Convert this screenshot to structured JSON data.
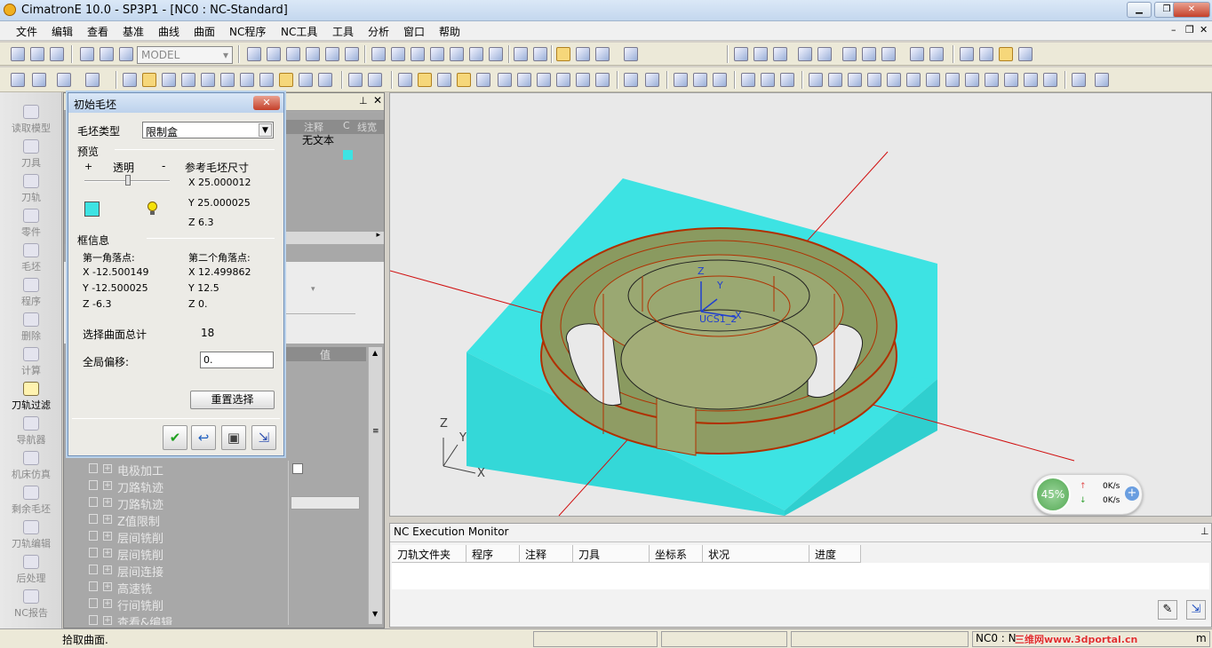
{
  "window": {
    "title": "CimatronE 10.0 - SP3P1 - [NC0 : NC-Standard]"
  },
  "menu": [
    "文件",
    "编辑",
    "查看",
    "基准",
    "曲线",
    "曲面",
    "NC程序",
    "NC工具",
    "工具",
    "分析",
    "窗口",
    "帮助"
  ],
  "model_combo": "MODEL",
  "sidebar": [
    {
      "label": "读取模型",
      "active": false
    },
    {
      "label": "刀具",
      "active": false
    },
    {
      "label": "刀轨",
      "active": false
    },
    {
      "label": "零件",
      "active": false
    },
    {
      "label": "毛坯",
      "active": false
    },
    {
      "label": "程序",
      "active": false
    },
    {
      "label": "删除",
      "active": false
    },
    {
      "label": "计算",
      "active": false
    },
    {
      "label": "刀轨过滤",
      "active": true
    },
    {
      "label": "导航器",
      "active": false
    },
    {
      "label": "机床仿真",
      "active": false
    },
    {
      "label": "剩余毛坯",
      "active": false
    },
    {
      "label": "刀轨编辑",
      "active": false
    },
    {
      "label": "后处理",
      "active": false
    },
    {
      "label": "NC报告",
      "active": false
    }
  ],
  "upper_panel": {
    "col_annotation": "注释",
    "col_c": "C",
    "col_wire": "线宽",
    "note_value": "无文本"
  },
  "param_panel": {
    "value_header": "值",
    "rows": [
      "电极加工",
      "刀路轨迹",
      "刀路轨迹",
      "Z值限制",
      "层间铣削",
      "层间铣削",
      "层间连接",
      "高速铣",
      "行间铣削",
      "查看&编辑"
    ]
  },
  "dialog": {
    "title": "初始毛坯",
    "stock_type_label": "毛坯类型",
    "stock_type_value": "限制盒",
    "preview_label": "预览",
    "plus": "+",
    "transparent_label": "透明",
    "minus": "-",
    "ref_size_label": "参考毛坯尺寸",
    "ref_x": "X  25.000012",
    "ref_y": "Y  25.000025",
    "ref_z": "Z  6.3",
    "box_info_label": "框信息",
    "corner1_label": "第一角落点:",
    "c1x": "X -12.500149",
    "c1y": "Y -12.500025",
    "c1z": "Z -6.3",
    "corner2_label": "第二个角落点:",
    "c2x": "X 12.499862",
    "c2y": "Y 12.5",
    "c2z": "Z 0.",
    "surface_total_label": "选择曲面总计",
    "surface_total_value": "18",
    "offset_label": "全局偏移:",
    "offset_value": "0.",
    "reset_label": "重置选择"
  },
  "viewport": {
    "ucs_label": "UCS1_2",
    "axis_z": "Z",
    "axis_y": "Y",
    "axis_x": "X",
    "triad_z": "Z",
    "triad_y": "Y",
    "triad_x": "X",
    "colors": {
      "stock": "#3de3e3",
      "part": "#8a9a60",
      "edge": "#b03000"
    }
  },
  "gauge": {
    "percent": "45%",
    "up": "0K/s",
    "down": "0K/s"
  },
  "monitor": {
    "title": "NC Execution Monitor",
    "columns": [
      "刀轨文件夹",
      "程序",
      "注释",
      "刀具",
      "坐标系",
      "状况",
      "进度"
    ]
  },
  "status": {
    "prompt": "拾取曲面.",
    "nc": "NC0 : N",
    "site": "三维网www.3dportal.cn",
    "tail": "m"
  }
}
